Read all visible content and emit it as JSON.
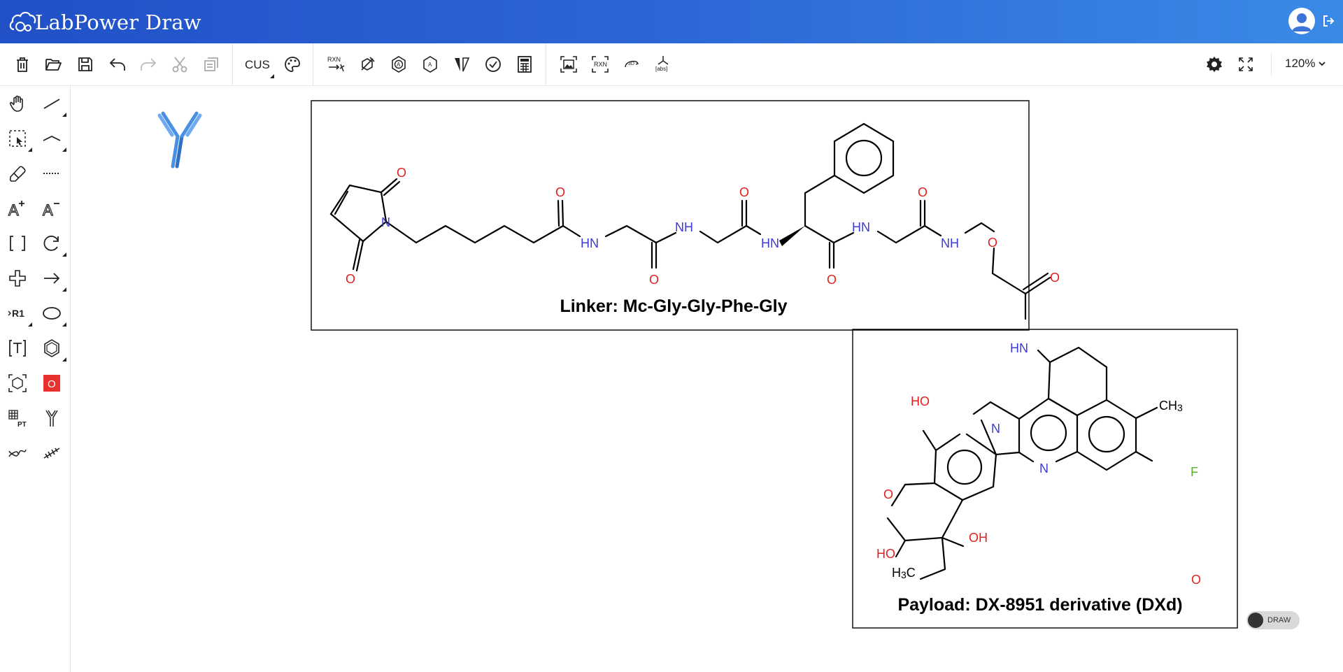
{
  "app": {
    "title": "LabPower Draw"
  },
  "toolbar": {
    "left_tools": [
      "delete-icon",
      "open-folder-icon",
      "save-icon",
      "undo-icon",
      "redo-icon",
      "cut-icon",
      "copy-icon"
    ],
    "cus_label": "CUS",
    "reaction_tools": [
      "rxn-auto-icon",
      "clean-icon",
      "aromatize-icon",
      "dearomatize-icon",
      "stereo-icon",
      "check-icon",
      "calculator-icon"
    ],
    "export_tools": [
      "image-export-icon",
      "rxn-export-icon",
      "3d-icon",
      "abs-icon"
    ],
    "abs_label": "[abs]",
    "rxn_label": "RXN",
    "three_d_label": "3D",
    "zoom_label": "120%"
  },
  "left_tools": [
    "hand-icon",
    "bond-icon",
    "select-icon",
    "wave-bond-icon",
    "eraser-icon",
    "dotted-bond-icon",
    "charge-plus-icon",
    "charge-minus-icon",
    "bracket-icon",
    "rotate-icon",
    "plus-icon",
    "arrow-icon",
    "r-group-icon",
    "ellipse-icon",
    "text-tool-icon",
    "benzene-icon",
    "template-icon",
    "atom-o-icon",
    "periodic-table-icon",
    "antibody-icon",
    "dna-icon",
    "rna-icon"
  ],
  "left_labels": {
    "r_group": "R1",
    "atom_o": "O"
  },
  "canvas": {
    "linker_label": "Linker: Mc-Gly-Gly-Phe-Gly",
    "payload_label": "Payload: DX-8951 derivative (DXd)",
    "toggle_label": "DRAW",
    "stray_atom": "O"
  },
  "atoms": {
    "o": "O",
    "n": "N",
    "hn": "HN",
    "nh": "NH",
    "oh": "OH",
    "ho": "HO",
    "f": "F",
    "ch3": "CH3",
    "h3c": "H3C"
  },
  "colors": {
    "header_start": "#2150c7",
    "header_end": "#3b8ae6",
    "oxygen": "#e02020",
    "nitrogen": "#3b3bd6",
    "fluorine": "#5cae2e",
    "antibody": "#4a90e2",
    "bond": "#000000"
  }
}
